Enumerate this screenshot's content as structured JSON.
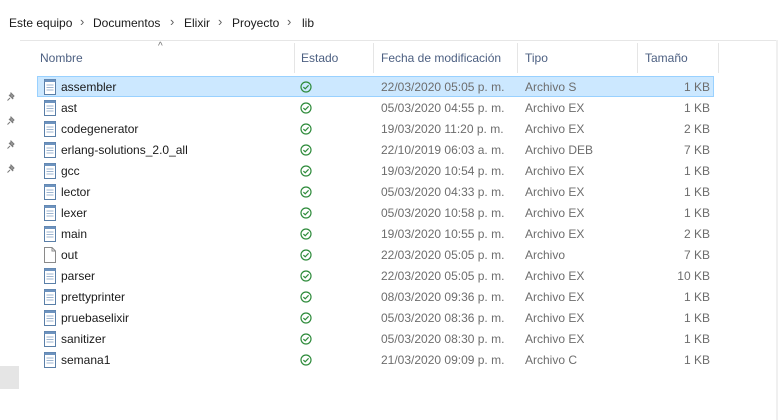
{
  "breadcrumb": [
    "Este equipo",
    "Documentos",
    "Elixir",
    "Proyecto",
    "lib"
  ],
  "columns": {
    "name": "Nombre",
    "status": "Estado",
    "date": "Fecha de modificación",
    "type": "Tipo",
    "size": "Tamaño"
  },
  "sort_indicator": "^",
  "colors": {
    "selected_bg": "#cce8ff",
    "selected_border": "#99d1ff",
    "status_green": "#2e8b3b",
    "header_text": "#4d6082"
  },
  "files": [
    {
      "name": "assembler",
      "status_icon": "synced-check-icon",
      "date": "22/03/2020 05:05 p. m.",
      "type": "Archivo S",
      "size": "1 KB",
      "icon": "text-document-icon",
      "selected": true
    },
    {
      "name": "ast",
      "status_icon": "synced-check-icon",
      "date": "05/03/2020 04:55 p. m.",
      "type": "Archivo EX",
      "size": "1 KB",
      "icon": "text-document-icon",
      "selected": false
    },
    {
      "name": "codegenerator",
      "status_icon": "synced-check-icon",
      "date": "19/03/2020 11:20 p. m.",
      "type": "Archivo EX",
      "size": "2 KB",
      "icon": "text-document-icon",
      "selected": false
    },
    {
      "name": "erlang-solutions_2.0_all",
      "status_icon": "synced-check-icon",
      "date": "22/10/2019 06:03 a. m.",
      "type": "Archivo DEB",
      "size": "7 KB",
      "icon": "text-document-icon",
      "selected": false
    },
    {
      "name": "gcc",
      "status_icon": "synced-check-icon",
      "date": "19/03/2020 10:54 p. m.",
      "type": "Archivo EX",
      "size": "1 KB",
      "icon": "text-document-icon",
      "selected": false
    },
    {
      "name": "lector",
      "status_icon": "synced-check-icon",
      "date": "05/03/2020 04:33 p. m.",
      "type": "Archivo EX",
      "size": "1 KB",
      "icon": "text-document-icon",
      "selected": false
    },
    {
      "name": "lexer",
      "status_icon": "synced-check-icon",
      "date": "05/03/2020 10:58 p. m.",
      "type": "Archivo EX",
      "size": "1 KB",
      "icon": "text-document-icon",
      "selected": false
    },
    {
      "name": "main",
      "status_icon": "synced-check-icon",
      "date": "19/03/2020 10:55 p. m.",
      "type": "Archivo EX",
      "size": "2 KB",
      "icon": "text-document-icon",
      "selected": false
    },
    {
      "name": "out",
      "status_icon": "synced-check-icon",
      "date": "22/03/2020 05:05 p. m.",
      "type": "Archivo",
      "size": "7 KB",
      "icon": "blank-file-icon",
      "selected": false
    },
    {
      "name": "parser",
      "status_icon": "synced-check-icon",
      "date": "22/03/2020 05:05 p. m.",
      "type": "Archivo EX",
      "size": "10 KB",
      "icon": "text-document-icon",
      "selected": false
    },
    {
      "name": "prettyprinter",
      "status_icon": "synced-check-icon",
      "date": "08/03/2020 09:36 p. m.",
      "type": "Archivo EX",
      "size": "1 KB",
      "icon": "text-document-icon",
      "selected": false
    },
    {
      "name": "pruebaselixir",
      "status_icon": "synced-check-icon",
      "date": "05/03/2020 08:36 p. m.",
      "type": "Archivo EX",
      "size": "1 KB",
      "icon": "text-document-icon",
      "selected": false
    },
    {
      "name": "sanitizer",
      "status_icon": "synced-check-icon",
      "date": "05/03/2020 08:30 p. m.",
      "type": "Archivo EX",
      "size": "1 KB",
      "icon": "text-document-icon",
      "selected": false
    },
    {
      "name": "semana1",
      "status_icon": "synced-check-icon",
      "date": "21/03/2020 09:09 p. m.",
      "type": "Archivo C",
      "size": "1 KB",
      "icon": "text-document-icon",
      "selected": false
    }
  ],
  "nav_pins": [
    "pin-icon",
    "pin-icon",
    "pin-icon",
    "pin-icon"
  ]
}
